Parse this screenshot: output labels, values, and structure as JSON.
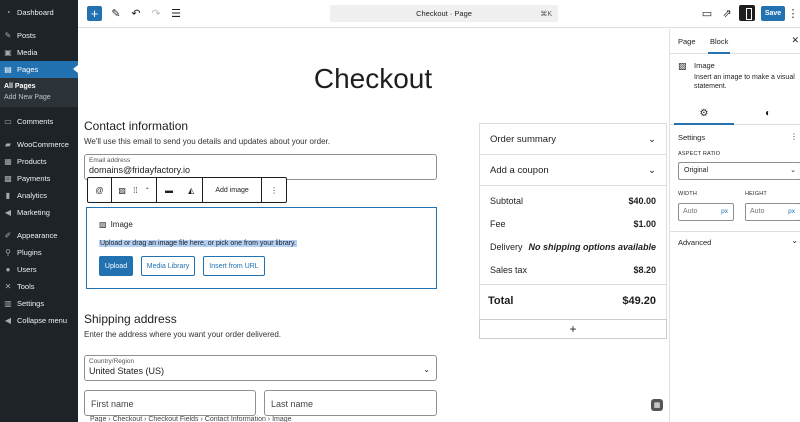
{
  "sidebar": {
    "items": [
      {
        "label": "Dashboard",
        "icon": "dashboard-icon"
      },
      {
        "label": "Posts",
        "icon": "pin-icon"
      },
      {
        "label": "Media",
        "icon": "media-icon"
      },
      {
        "label": "Pages",
        "icon": "pages-icon"
      },
      {
        "label": "Comments",
        "icon": "comment-icon"
      },
      {
        "label": "WooCommerce",
        "icon": "woo-icon"
      },
      {
        "label": "Products",
        "icon": "products-icon"
      },
      {
        "label": "Payments",
        "icon": "payments-icon"
      },
      {
        "label": "Analytics",
        "icon": "analytics-icon"
      },
      {
        "label": "Marketing",
        "icon": "megaphone-icon"
      },
      {
        "label": "Appearance",
        "icon": "brush-icon"
      },
      {
        "label": "Plugins",
        "icon": "plugin-icon"
      },
      {
        "label": "Users",
        "icon": "users-icon"
      },
      {
        "label": "Tools",
        "icon": "wrench-icon"
      },
      {
        "label": "Settings",
        "icon": "settings-icon"
      },
      {
        "label": "Collapse menu",
        "icon": "collapse-icon"
      }
    ],
    "pages_sub": {
      "all": "All Pages",
      "add": "Add New Page"
    }
  },
  "topbar": {
    "doc_title": "Checkout · Page",
    "shortcut": "⌘K",
    "save_label": "Save"
  },
  "canvas": {
    "page_title": "Checkout",
    "contact": {
      "title": "Contact information",
      "desc": "We'll use this email to send you details and updates about your order.",
      "email_label": "Email address",
      "email_value": "domains@fridayfactory.io"
    },
    "block_toolbar": {
      "add_image": "Add image"
    },
    "image_block": {
      "title": "Image",
      "hint": "Upload or drag an image file here, or pick one from your library.",
      "upload": "Upload",
      "library": "Media Library",
      "url": "Insert from URL"
    },
    "shipping": {
      "title": "Shipping address",
      "desc": "Enter the address where you want your order delivered.",
      "country_label": "Country/Region",
      "country_value": "United States (US)",
      "first_name": "First name",
      "last_name": "Last name"
    },
    "summary": {
      "title": "Order summary",
      "coupon": "Add a coupon",
      "subtotal_label": "Subtotal",
      "subtotal_value": "$40.00",
      "fee_label": "Fee",
      "fee_value": "$1.00",
      "delivery_label": "Delivery",
      "delivery_value": "No shipping options available",
      "tax_label": "Sales tax",
      "tax_value": "$8.20",
      "total_label": "Total",
      "total_value": "$49.20"
    },
    "breadcrumbs": "Page  ›  Checkout  ›  Checkout Fields  ›  Contact Information  ›  Image"
  },
  "panel": {
    "tab_page": "Page",
    "tab_block": "Block",
    "block_name": "Image",
    "block_desc": "Insert an image to make a visual statement.",
    "settings_title": "Settings",
    "aspect_label": "ASPECT RATIO",
    "aspect_value": "Original",
    "width_label": "WIDTH",
    "height_label": "HEIGHT",
    "auto": "Auto",
    "unit": "px",
    "advanced": "Advanced"
  }
}
